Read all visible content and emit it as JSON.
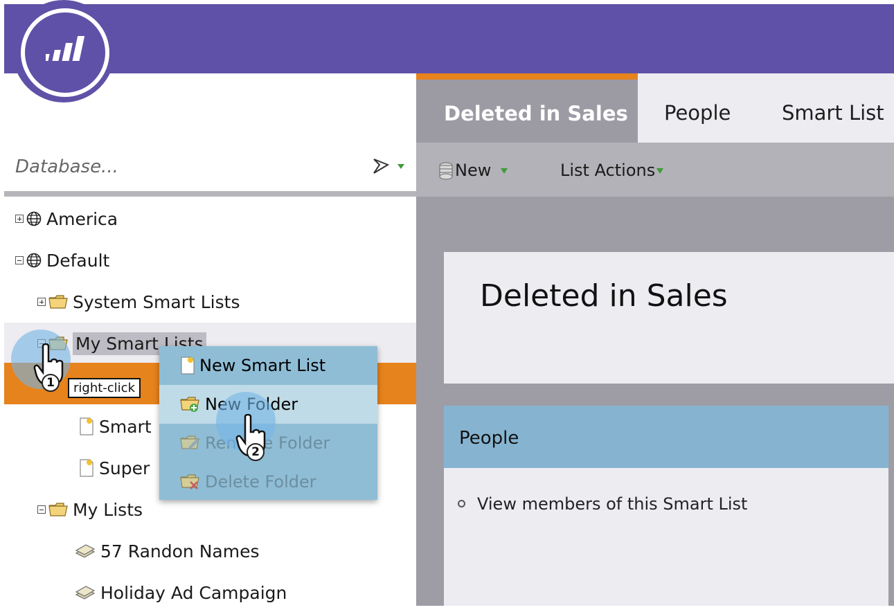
{
  "tabs": [
    {
      "label": "Deleted in Sales",
      "active": true
    },
    {
      "label": "People",
      "active": false
    },
    {
      "label": "Smart List",
      "active": false
    }
  ],
  "toolbar": {
    "new_label": "New",
    "list_actions_label": "List Actions"
  },
  "search": {
    "placeholder": "Database..."
  },
  "tree": {
    "america": "America",
    "default": "Default",
    "system_smart_lists": "System Smart Lists",
    "my_smart_lists": "My Smart Lists",
    "smart_item": "Smart",
    "super_item": "Super",
    "my_lists": "My Lists",
    "list_57": "57 Randon Names",
    "holiday": "Holiday Ad Campaign"
  },
  "context_menu": {
    "new_smart_list": "New Smart List",
    "new_folder": "New Folder",
    "rename_folder": "Rename Folder",
    "delete_folder": "Delete Folder"
  },
  "annotations": {
    "step1": "1",
    "step1_label": "right-click",
    "step2": "2"
  },
  "content": {
    "title": "Deleted in Sales",
    "people_header": "People",
    "people_item": "View members of this Smart List"
  },
  "colors": {
    "brand_purple": "#5f51a7",
    "accent_orange": "#e6831c",
    "panel_blue": "#86b4d0"
  }
}
